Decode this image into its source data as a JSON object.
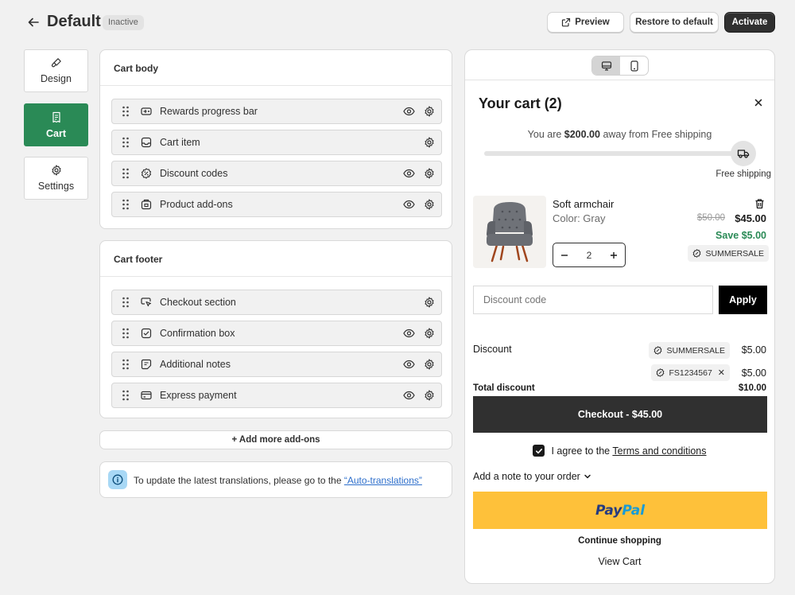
{
  "header": {
    "title": "Default",
    "status_badge": "Inactive",
    "preview_label": "Preview",
    "restore_label": "Restore to default",
    "activate_label": "Activate"
  },
  "nav": [
    {
      "label": "Design",
      "icon": "brush-icon"
    },
    {
      "label": "Cart",
      "icon": "receipt-icon",
      "active": true
    },
    {
      "label": "Settings",
      "icon": "gear-icon"
    }
  ],
  "cart_body": {
    "title": "Cart body",
    "rows": [
      {
        "label": "Rewards progress bar",
        "icon": "progress-bar-icon",
        "visible_toggle": true
      },
      {
        "label": "Cart item",
        "icon": "inbox-icon",
        "visible_toggle": false
      },
      {
        "label": "Discount codes",
        "icon": "discount-icon",
        "visible_toggle": true
      },
      {
        "label": "Product add-ons",
        "icon": "addon-icon",
        "visible_toggle": true
      }
    ]
  },
  "cart_footer": {
    "title": "Cart footer",
    "rows": [
      {
        "label": "Checkout section",
        "icon": "cursor-icon",
        "visible_toggle": false
      },
      {
        "label": "Confirmation box",
        "icon": "checkbox-icon",
        "visible_toggle": true
      },
      {
        "label": "Additional notes",
        "icon": "note-icon",
        "visible_toggle": true
      },
      {
        "label": "Express payment",
        "icon": "credit-card-icon",
        "visible_toggle": true
      }
    ]
  },
  "add_more_label": "+ Add more add-ons",
  "info": {
    "text": "To update the latest translations, please go to the ",
    "link": "“Auto-translations”"
  },
  "preview": {
    "cart_title": "Your cart (2)",
    "shipping": {
      "prefix": "You are ",
      "amount": "$200.00",
      "suffix": " away from Free shipping",
      "progress_fraction": 0.0,
      "goal_label": "Free shipping"
    },
    "item": {
      "name": "Soft armchair",
      "variant": "Color: Gray",
      "old_price": "$50.00",
      "price": "$45.00",
      "savings": "Save $5.00",
      "quantity": "2",
      "code": "SUMMERSALE"
    },
    "discount_placeholder": "Discount code",
    "apply_label": "Apply",
    "summary": {
      "discount_label": "Discount",
      "codes": [
        {
          "code": "SUMMERSALE",
          "amount": "$5.00",
          "removable": false
        },
        {
          "code": "FS1234567",
          "amount": "$5.00",
          "removable": true
        }
      ],
      "total_label": "Total discount",
      "total_value": "$10.00"
    },
    "checkout_label": "Checkout - $45.00",
    "agree_prefix": "I agree to the ",
    "terms_label": "Terms and conditions",
    "note_label": "Add a note to your order",
    "paypal_part1": "Pay",
    "paypal_part2": "Pal",
    "continue_label": "Continue shopping",
    "view_cart_label": "View Cart"
  },
  "colors": {
    "accent_green": "#2a8a56",
    "paypal_yellow": "#fec13a",
    "dark": "#303030",
    "link_blue": "#2c6ecb"
  }
}
